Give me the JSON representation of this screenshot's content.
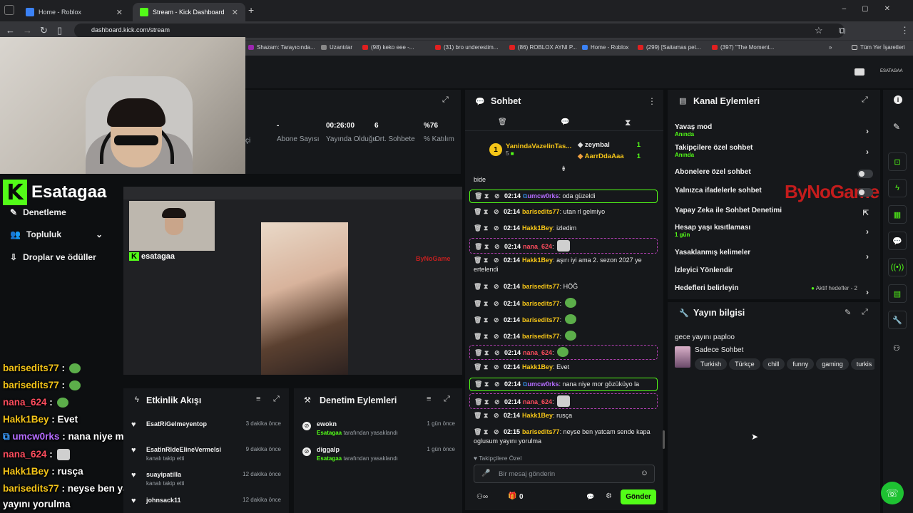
{
  "browser": {
    "tabs": [
      {
        "label": "Home - Roblox",
        "color": "#3b82f6"
      },
      {
        "label": "Stream - Kick Dashboard",
        "color": "#53fc18"
      }
    ],
    "new_tab": "+",
    "url": "dashboard.kick.com/stream",
    "bookmarks": [
      "Shazam: Tarayıcında...",
      "Uzantılar",
      "(98) keko eee -...",
      "(31) bro underestim...",
      "(86) ROBLOX AYNI P...",
      "Home - Roblox",
      "(299) [Saitamas pet...",
      "(397) \"The Moment...",
      "Tüm Yer İşaretleri"
    ]
  },
  "topbar": {
    "user": "ESATAGAA"
  },
  "stream": {
    "stats": [
      {
        "value": "-",
        "label": "Abone Sayısı"
      },
      {
        "value": "00:26:00",
        "label": "Yayında Olduğu"
      },
      {
        "value": "6",
        "label": "Ort. Sohbete"
      },
      {
        "value": "%76",
        "label": "% Katılım"
      }
    ],
    "partial_label": "çi"
  },
  "overlay": {
    "channel": "Esatagaa",
    "nav": [
      {
        "label": "Denetleme"
      },
      {
        "label": "Topluluk"
      },
      {
        "label": "Droplar ve ödüller"
      }
    ],
    "chat": [
      {
        "user": "barisedits77",
        "color": "#f5c518",
        "text": "",
        "emote": "pepe"
      },
      {
        "user": "barisedits77",
        "color": "#f5c518",
        "text": "",
        "emote": "pepe"
      },
      {
        "user": "nana_624",
        "color": "#ff4d5e",
        "text": "",
        "emote": "pepe"
      },
      {
        "user": "Hakk1Bey",
        "color": "#f5c518",
        "text": "Evet",
        "emote": ""
      },
      {
        "user": "umcw0rks",
        "color": "#b56cff",
        "text": "nana niye mor gözüküyo la",
        "emote": ""
      },
      {
        "user": "nana_624",
        "color": "#ff4d5e",
        "text": "",
        "emote": "cat"
      },
      {
        "user": "Hakk1Bey",
        "color": "#f5c518",
        "text": "rusça",
        "emote": ""
      },
      {
        "user": "barisedits77",
        "color": "#f5c518",
        "text": "neyse ben yatcam sende kapa oglusum",
        "emote": ""
      }
    ],
    "chat_tail": "yayını yorulma"
  },
  "activity": {
    "title": "Etkinlik Akışı",
    "items": [
      {
        "name": "EsatRiGelmeyentop",
        "sub": "",
        "time": "3 dakika önce"
      },
      {
        "name": "EsatinRIdeElineVermelsi",
        "sub": "kanalı takip etti",
        "time": "9 dakika önce"
      },
      {
        "name": "suayipatilla",
        "sub": "kanalı takip etti",
        "time": "12 dakika önce"
      },
      {
        "name": "johnsack11",
        "sub": "",
        "time": "12 dakika önce"
      }
    ]
  },
  "moderation": {
    "title": "Denetim Eylemleri",
    "items": [
      {
        "name": "ewokn",
        "by": "Esatagaa",
        "action": "tarafından yasaklandı",
        "time": "1 gün önce"
      },
      {
        "name": "diggalp",
        "by": "Esatagaa",
        "action": "tarafından yasaklandı",
        "time": "1 gün önce"
      }
    ]
  },
  "chat": {
    "title": "Sohbet",
    "top_gifter": "YanindaVazelinTas...",
    "top_gifter_count": "5",
    "leaders": [
      {
        "name": "zeynbal",
        "count": "1"
      },
      {
        "name": "AarrDdaAaa",
        "count": "1"
      }
    ],
    "first_line": "bide",
    "messages": [
      {
        "time": "02:14",
        "user": "umcw0rks",
        "ucolor": "purple",
        "text": "oda güzeldi",
        "style": "hl",
        "emote": ""
      },
      {
        "time": "02:14",
        "user": "barisedits77",
        "ucolor": "yellow",
        "text": "utan rl gelmiyo",
        "style": "",
        "emote": ""
      },
      {
        "time": "02:14",
        "user": "Hakk1Bey",
        "ucolor": "yellow",
        "text": "izledim",
        "style": "",
        "emote": ""
      },
      {
        "time": "02:14",
        "user": "nana_624",
        "ucolor": "red",
        "text": "",
        "style": "ds",
        "emote": "cat"
      },
      {
        "time": "02:14",
        "user": "Hakk1Bey",
        "ucolor": "yellow",
        "text": "aşırı iyi ama 2. sezon 2027 ye ertelendi",
        "style": "",
        "emote": ""
      },
      {
        "time": "02:14",
        "user": "barisedits77",
        "ucolor": "yellow",
        "text": "HÖĞ",
        "style": "",
        "emote": ""
      },
      {
        "time": "02:14",
        "user": "barisedits77",
        "ucolor": "yellow",
        "text": "",
        "style": "",
        "emote": "pepe"
      },
      {
        "time": "02:14",
        "user": "barisedits77",
        "ucolor": "yellow",
        "text": "",
        "style": "",
        "emote": "pepe"
      },
      {
        "time": "02:14",
        "user": "barisedits77",
        "ucolor": "yellow",
        "text": "",
        "style": "",
        "emote": "pepe"
      },
      {
        "time": "02:14",
        "user": "nana_624",
        "ucolor": "red",
        "text": "",
        "style": "ds",
        "emote": "pepe"
      },
      {
        "time": "02:14",
        "user": "Hakk1Bey",
        "ucolor": "yellow",
        "text": "Evet",
        "style": "",
        "emote": ""
      },
      {
        "time": "02:14",
        "user": "umcw0rks",
        "ucolor": "purple",
        "text": "nana niye mor gözüküyo la",
        "style": "hl",
        "emote": ""
      },
      {
        "time": "02:14",
        "user": "nana_624",
        "ucolor": "red",
        "text": "",
        "style": "ds",
        "emote": "cat"
      },
      {
        "time": "02:14",
        "user": "Hakk1Bey",
        "ucolor": "yellow",
        "text": "rusça",
        "style": "",
        "emote": ""
      },
      {
        "time": "02:15",
        "user": "barisedits77",
        "ucolor": "yellow",
        "text": "neyse ben yatcam sende kapa oglusum yayını yorulma",
        "style": "",
        "emote": ""
      }
    ],
    "followers_only": "Takipçilere Özel",
    "input_placeholder": "Bir mesaj gönderin",
    "points": "0",
    "send": "Gönder"
  },
  "channel_actions": {
    "title": "Kanal Eylemleri",
    "items": [
      {
        "label": "Yavaş mod",
        "sub": "Anında",
        "control": "chevron"
      },
      {
        "label": "Takipçilere özel sohbet",
        "sub": "Anında",
        "control": "chevron"
      },
      {
        "label": "Abonelere özel sohbet",
        "sub": "",
        "control": "toggle"
      },
      {
        "label": "Yalnızca ifadelerle sohbet",
        "sub": "",
        "control": "toggle"
      },
      {
        "label": "Yapay Zeka ile Sohbet Denetimi",
        "sub": "",
        "control": "external"
      },
      {
        "label": "Hesap yaşı kısıtlaması",
        "sub": "1 gün",
        "control": "chevron"
      },
      {
        "label": "Yasaklanmış kelimeler",
        "sub": "",
        "control": "chevron"
      },
      {
        "label": "İzleyici Yönlendir",
        "sub": "",
        "control": "none"
      },
      {
        "label": "Hedefleri belirleyin",
        "sub": "",
        "control": "chevron"
      }
    ],
    "goals_status": "Aktif hedefler - 2",
    "watermark": "ByNoGame"
  },
  "stream_info": {
    "title": "Yayın bilgisi",
    "stream_title": "gece yayını paploo",
    "category": "Sadece Sohbet",
    "tags": [
      "Turkish",
      "Türkçe",
      "chill",
      "funny",
      "gaming",
      "turkis"
    ]
  }
}
